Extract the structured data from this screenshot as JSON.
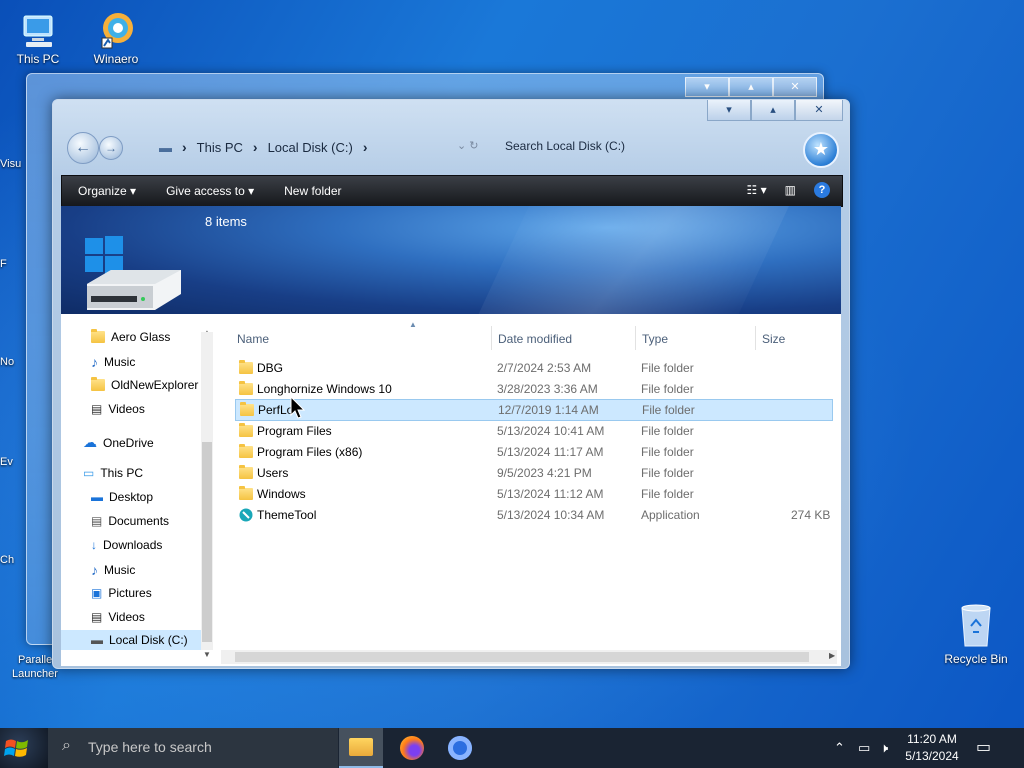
{
  "desktop": {
    "icons": [
      {
        "label": "This PC",
        "icon": "computer-icon"
      },
      {
        "label": "Winaero",
        "icon": "winaero-icon"
      },
      {
        "label": "Recycle Bin",
        "icon": "recycle-bin-icon"
      }
    ],
    "partial_labels": [
      "Visu",
      "F",
      "No",
      "Ev",
      "Ch",
      "Paralle",
      "Launcher"
    ]
  },
  "window": {
    "caption_buttons": {
      "minimize": "▾",
      "maximize": "▴",
      "close": "✕"
    },
    "breadcrumb": [
      "This PC",
      "Local Disk (C:)"
    ],
    "search_placeholder": "Search Local Disk (C:)",
    "toolbar": {
      "organize": "Organize",
      "give_access": "Give access to",
      "new_folder": "New folder",
      "help": "?"
    },
    "item_count": "8 items"
  },
  "nav_pane": [
    {
      "label": "Aero Glass",
      "icon": "folder-icon"
    },
    {
      "label": "Music",
      "icon": "music-icon"
    },
    {
      "label": "OldNewExplorer",
      "icon": "folder-icon"
    },
    {
      "label": "Videos",
      "icon": "videos-icon"
    },
    {
      "label": "OneDrive",
      "icon": "cloud-icon"
    },
    {
      "label": "This PC",
      "icon": "computer-icon"
    },
    {
      "label": "Desktop",
      "icon": "desktop-icon"
    },
    {
      "label": "Documents",
      "icon": "documents-icon"
    },
    {
      "label": "Downloads",
      "icon": "downloads-icon"
    },
    {
      "label": "Music",
      "icon": "music-icon"
    },
    {
      "label": "Pictures",
      "icon": "pictures-icon"
    },
    {
      "label": "Videos",
      "icon": "videos-icon"
    },
    {
      "label": "Local Disk (C:)",
      "icon": "drive-icon"
    }
  ],
  "columns": {
    "name": "Name",
    "date": "Date modified",
    "type": "Type",
    "size": "Size"
  },
  "files": [
    {
      "name": "DBG",
      "date": "2/7/2024 2:53 AM",
      "type": "File folder",
      "size": ""
    },
    {
      "name": "Longhornize Windows 10",
      "date": "3/28/2023 3:36 AM",
      "type": "File folder",
      "size": ""
    },
    {
      "name": "PerfLo",
      "date": "12/7/2019 1:14 AM",
      "type": "File folder",
      "size": ""
    },
    {
      "name": "Program Files",
      "date": "5/13/2024 10:41 AM",
      "type": "File folder",
      "size": ""
    },
    {
      "name": "Program Files (x86)",
      "date": "5/13/2024 11:17 AM",
      "type": "File folder",
      "size": ""
    },
    {
      "name": "Users",
      "date": "9/5/2023 4:21 PM",
      "type": "File folder",
      "size": ""
    },
    {
      "name": "Windows",
      "date": "5/13/2024 11:12 AM",
      "type": "File folder",
      "size": ""
    },
    {
      "name": "ThemeTool",
      "date": "5/13/2024 10:34 AM",
      "type": "Application",
      "size": "274 KB"
    }
  ],
  "taskbar": {
    "search_placeholder": "Type here to search",
    "time": "11:20 AM",
    "date": "5/13/2024"
  },
  "colors": {
    "selection": "#cce8ff",
    "toolbar": "#1e2126",
    "taskbar": "#1a2433"
  }
}
